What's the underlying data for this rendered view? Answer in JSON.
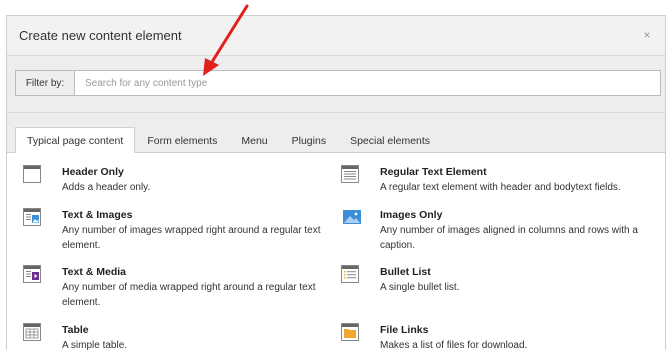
{
  "modal": {
    "title": "Create new content element",
    "close_glyph": "×"
  },
  "filter": {
    "label": "Filter by:",
    "placeholder": "Search for any content type"
  },
  "tabs": [
    {
      "label": "Typical page content",
      "active": true
    },
    {
      "label": "Form elements",
      "active": false
    },
    {
      "label": "Menu",
      "active": false
    },
    {
      "label": "Plugins",
      "active": false
    },
    {
      "label": "Special elements",
      "active": false
    }
  ],
  "items": [
    {
      "title": "Header Only",
      "description": "Adds a header only.",
      "icon": "header-only-icon"
    },
    {
      "title": "Regular Text Element",
      "description": "A regular text element with header and bodytext fields.",
      "icon": "text-element-icon"
    },
    {
      "title": "Text & Images",
      "description": "Any number of images wrapped right around a regular text element.",
      "icon": "text-images-icon"
    },
    {
      "title": "Images Only",
      "description": "Any number of images aligned in columns and rows with a caption.",
      "icon": "images-only-icon"
    },
    {
      "title": "Text & Media",
      "description": "Any number of media wrapped right around a regular text element.",
      "icon": "text-media-icon"
    },
    {
      "title": "Bullet List",
      "description": "A single bullet list.",
      "icon": "bullet-list-icon"
    },
    {
      "title": "Table",
      "description": "A simple table.",
      "icon": "table-icon"
    },
    {
      "title": "File Links",
      "description": "Makes a list of files for download.",
      "icon": "file-links-icon"
    }
  ],
  "colors": {
    "annotation_arrow": "#e0201b",
    "image_icon_blue": "#3b8fd6",
    "media_icon_purple": "#6a2c91",
    "file_icon_orange": "#f0a830"
  }
}
